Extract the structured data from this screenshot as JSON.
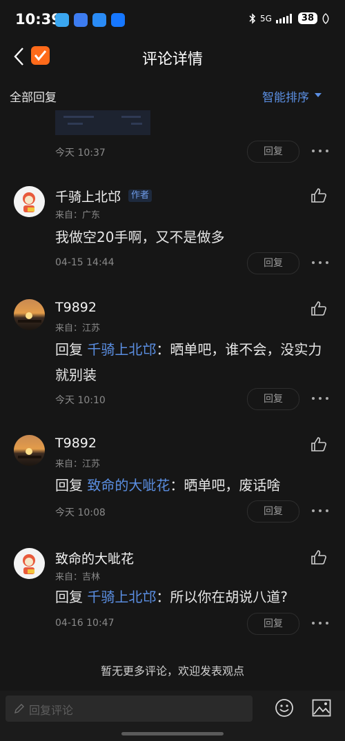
{
  "status": {
    "time": "10:39",
    "network": "5G",
    "battery": "38"
  },
  "header": {
    "title": "评论详情"
  },
  "sortbar": {
    "all_label": "全部回复",
    "sort_label": "智能排序"
  },
  "first_item": {
    "date": "今天 10:37",
    "reply_label": "回复"
  },
  "comments": [
    {
      "user": "千骑上北邙",
      "badge": "作者",
      "location": "来自：广东",
      "content": "我做空20手啊，又不是做多",
      "reply_prefix": "",
      "mention": "",
      "date": "04-15 14:44",
      "reply_label": "回复"
    },
    {
      "user": "T9892",
      "badge": "",
      "location": "来自：江苏",
      "reply_prefix": "回复 ",
      "mention": "千骑上北邙",
      "content": "：晒单吧，谁不会，没实力就别装",
      "date": "今天 10:10",
      "reply_label": "回复"
    },
    {
      "user": "T9892",
      "badge": "",
      "location": "来自：江苏",
      "reply_prefix": "回复 ",
      "mention": "致命的大呲花",
      "content": "：晒单吧，废话啥",
      "date": "今天 10:08",
      "reply_label": "回复"
    },
    {
      "user": "致命的大呲花",
      "badge": "",
      "location": "来自：吉林",
      "reply_prefix": "回复 ",
      "mention": "千骑上北邙",
      "content": "：所以你在胡说八道?",
      "date": "04-16 10:47",
      "reply_label": "回复"
    }
  ],
  "footer": {
    "no_more": "暂无更多评论，欢迎发表观点",
    "input_placeholder": "回复评论"
  }
}
